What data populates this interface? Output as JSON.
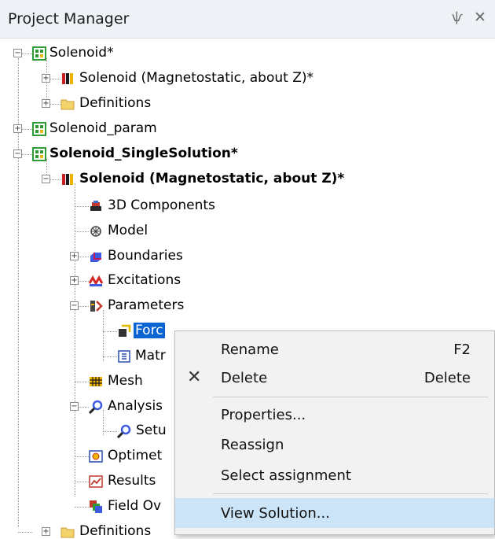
{
  "panel": {
    "title": "Project Manager",
    "pin_glyph": "ѱ",
    "close_glyph": "✕"
  },
  "tree": {
    "solenoid": "Solenoid*",
    "solenoid_design": "Solenoid (Magnetostatic, about Z)*",
    "definitions_1": "Definitions",
    "solenoid_param": "Solenoid_param",
    "single_solution": "Solenoid_SingleSolution*",
    "single_design": "Solenoid (Magnetostatic, about Z)*",
    "components_3d": "3D Components",
    "model": "Model",
    "boundaries": "Boundaries",
    "excitations": "Excitations",
    "parameters": "Parameters",
    "force": "Forc",
    "matrix": "Matr",
    "mesh": "Mesh",
    "analysis": "Analysis",
    "setup": "Setu",
    "optimetrics": "Optimet",
    "results": "Results",
    "field_overlays": "Field Ov",
    "definitions_2": "Definitions"
  },
  "context_menu": {
    "rename": "Rename",
    "rename_key": "F2",
    "delete": "Delete",
    "delete_key": "Delete",
    "delete_glyph": "✕",
    "properties": "Properties...",
    "reassign": "Reassign",
    "select_assignment": "Select assignment",
    "view_solution": "View Solution..."
  },
  "colors": {
    "selection": "#0a64d2",
    "menu_highlight": "#cce4f7",
    "titlebar": "#eef1f6"
  }
}
